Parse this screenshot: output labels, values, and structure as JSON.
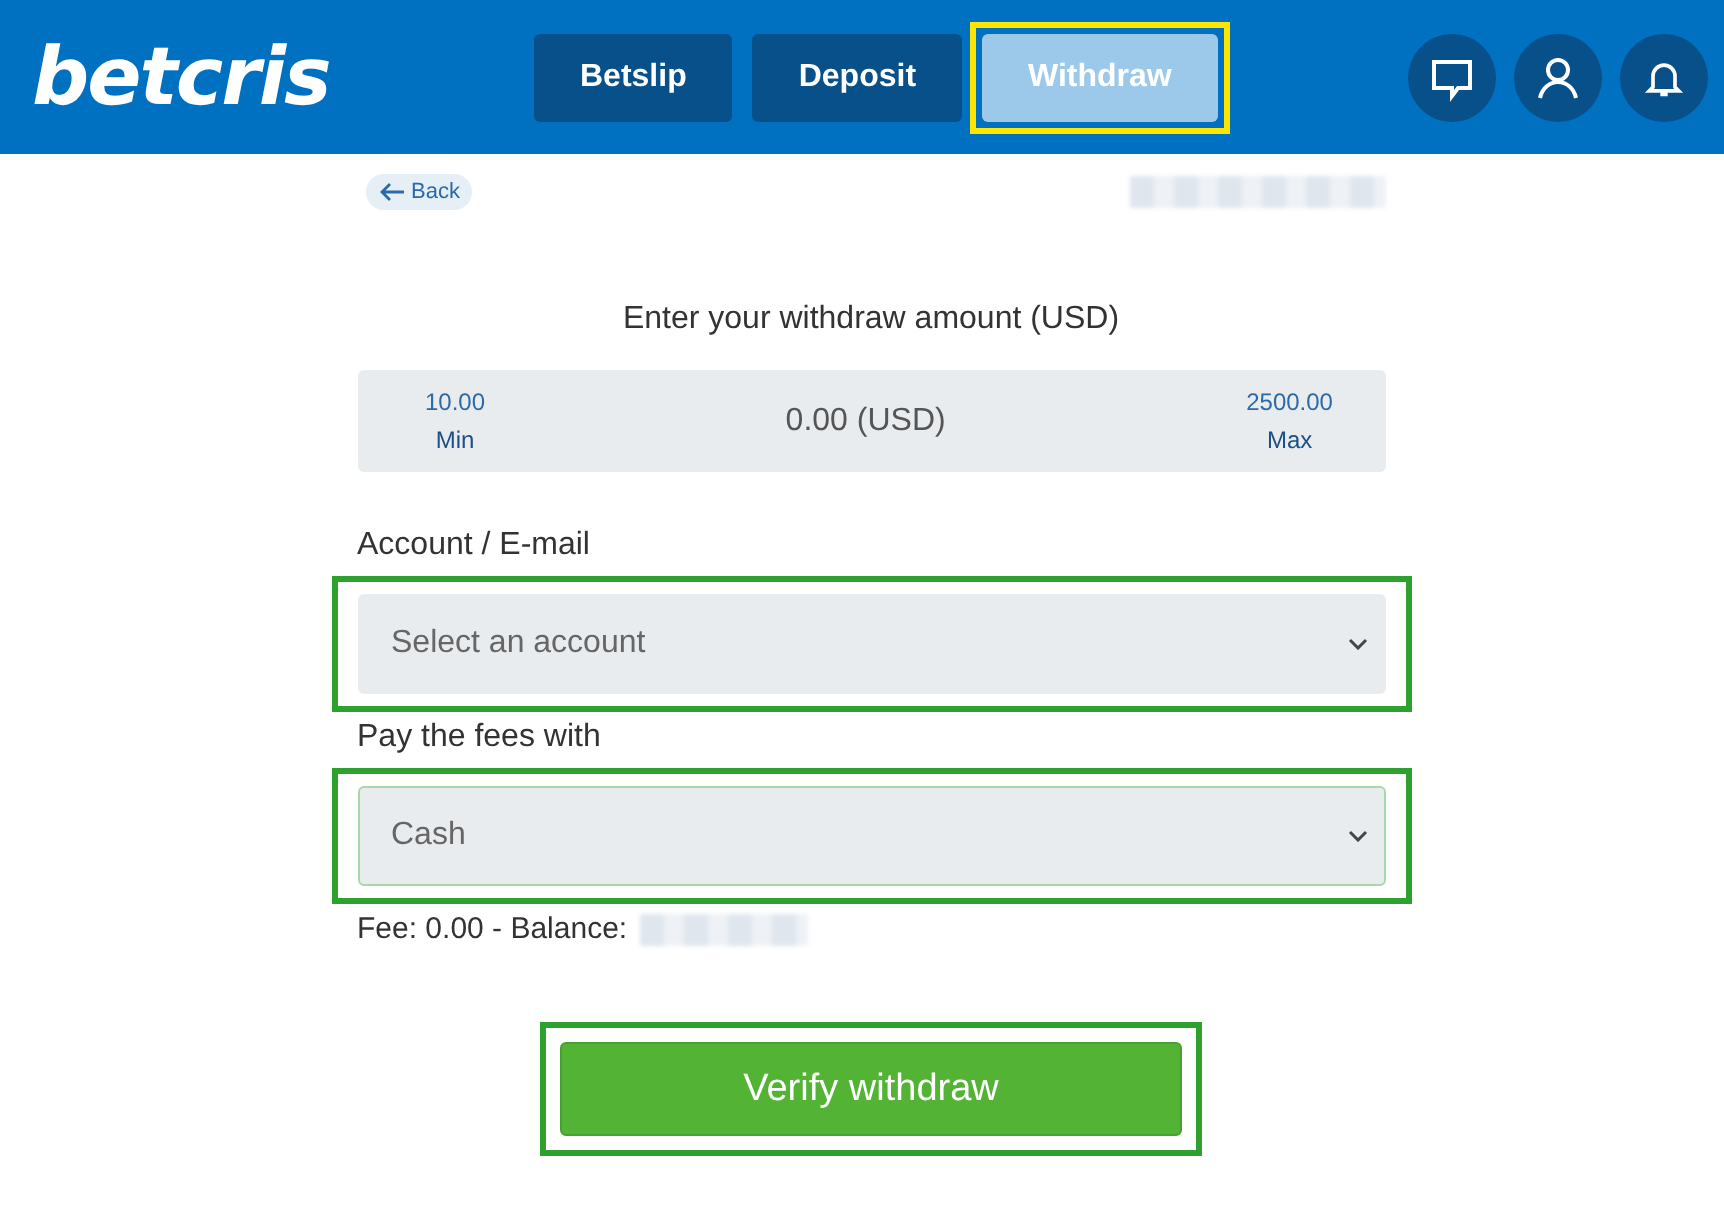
{
  "header": {
    "logo": "betcris",
    "tabs": [
      {
        "label": "Betslip",
        "selected": false,
        "highlighted": false
      },
      {
        "label": "Deposit",
        "selected": false,
        "highlighted": false
      },
      {
        "label": "Withdraw",
        "selected": true,
        "highlighted": true
      }
    ]
  },
  "back": {
    "label": "Back"
  },
  "amount": {
    "title": "Enter your withdraw amount (USD)",
    "min_value": "10.00",
    "min_label": "Min",
    "value": "0.00 (USD)",
    "max_value": "2500.00",
    "max_label": "Max"
  },
  "fields": [
    {
      "label": "Account / E-mail",
      "value": "Select an account",
      "highlighted": true,
      "focused": false
    },
    {
      "label": "Pay the fees with",
      "value": "Cash",
      "highlighted": true,
      "focused": true
    }
  ],
  "fee": "Fee: 0.00 - Balance:",
  "submit": {
    "label": "Verify withdraw",
    "highlighted": true
  }
}
